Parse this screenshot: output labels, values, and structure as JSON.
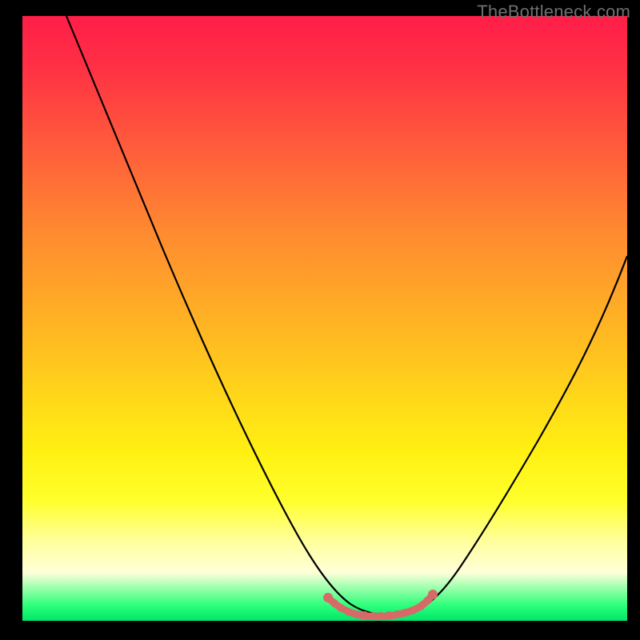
{
  "watermark": "TheBottleneck.com",
  "chart_data": {
    "type": "line",
    "title": "",
    "xlabel": "",
    "ylabel": "",
    "xlim": [
      0,
      100
    ],
    "ylim": [
      0,
      100
    ],
    "series": [
      {
        "name": "curve",
        "color": "#000000",
        "x": [
          8,
          14,
          20,
          26,
          32,
          38,
          44,
          48,
          52,
          56,
          60,
          64,
          68,
          74,
          80,
          86,
          92,
          100
        ],
        "y": [
          100,
          88,
          76,
          64,
          52,
          40,
          28,
          18,
          9,
          4,
          2,
          2,
          4,
          10,
          20,
          32,
          45,
          61
        ]
      }
    ],
    "bottom_highlight": {
      "name": "flat-region",
      "color": "#d76a68",
      "x": [
        52,
        54,
        56,
        58,
        60,
        62,
        64,
        66,
        68
      ],
      "y": [
        3.5,
        2.5,
        2.2,
        2.0,
        2.0,
        2.0,
        2.2,
        2.8,
        3.6
      ]
    },
    "gradient_stops": [
      {
        "pos": 0.0,
        "color": "#ff1e49"
      },
      {
        "pos": 0.22,
        "color": "#ff5d3b"
      },
      {
        "pos": 0.5,
        "color": "#ffb124"
      },
      {
        "pos": 0.72,
        "color": "#fff012"
      },
      {
        "pos": 0.92,
        "color": "#ffffd8"
      },
      {
        "pos": 1.0,
        "color": "#00e66a"
      }
    ]
  }
}
